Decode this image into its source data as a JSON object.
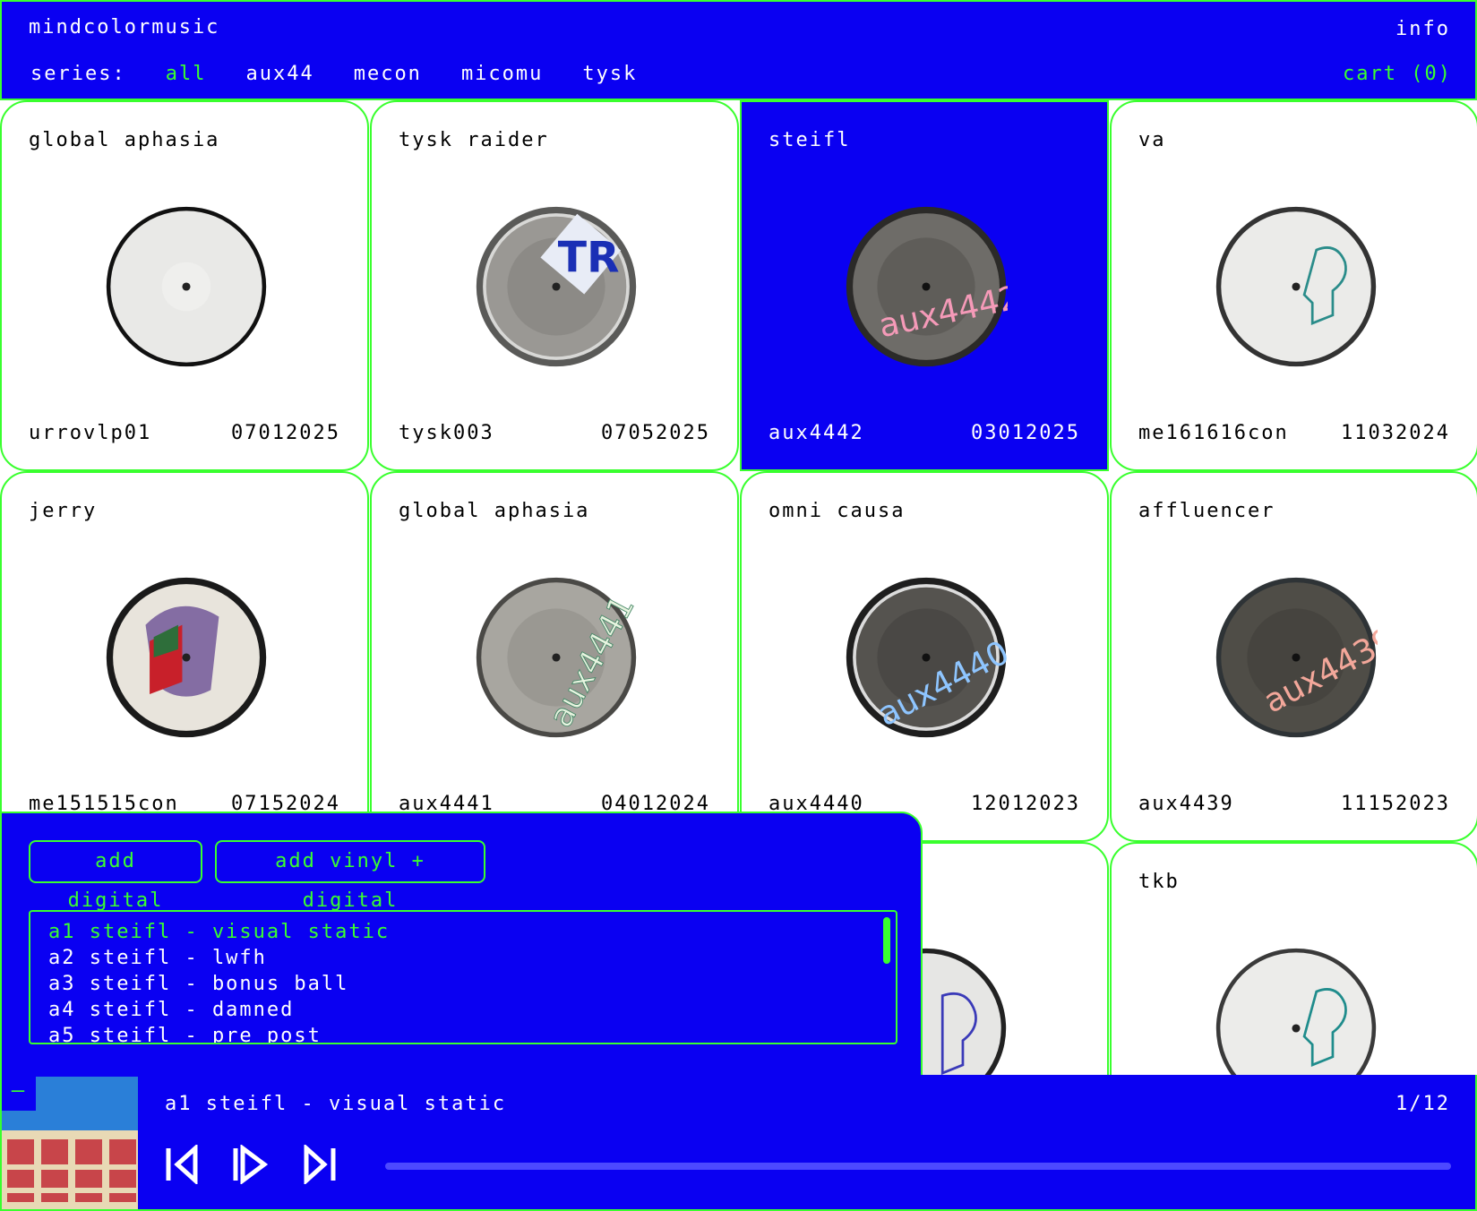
{
  "header": {
    "title": "mindcolormusic",
    "info_label": "info",
    "series_label": "series:",
    "series": [
      "all",
      "aux44",
      "mecon",
      "micomu",
      "tysk"
    ],
    "active_series": "all",
    "cart_label": "cart (0)"
  },
  "releases": [
    {
      "artist": "global aphasia",
      "catno": "urrovlp01",
      "date": "07012025",
      "disc": "white-plain"
    },
    {
      "artist": "tysk raider",
      "catno": "tysk003",
      "date": "07052025",
      "disc": "silver-tr-logo"
    },
    {
      "artist": "steifl",
      "catno": "aux4442",
      "date": "03012025",
      "disc": "dark-aux-pink",
      "selected": true
    },
    {
      "artist": "va",
      "catno": "me161616con",
      "date": "11032024",
      "disc": "white-mecon-logo"
    },
    {
      "artist": "jerry",
      "catno": "me151515con",
      "date": "07152024",
      "disc": "illustrated-mecon"
    },
    {
      "artist": "global aphasia",
      "catno": "aux4441",
      "date": "04012024",
      "disc": "silver-aux-holo"
    },
    {
      "artist": "omni causa",
      "catno": "aux4440",
      "date": "12012023",
      "disc": "dark-aux-blue"
    },
    {
      "artist": "affluencer",
      "catno": "aux4439",
      "date": "11152023",
      "disc": "dark-aux-salmon"
    },
    {
      "artist": "",
      "catno": "",
      "date": "",
      "disc": "white-mecon-blue"
    },
    {
      "artist": "tkb",
      "catno": "",
      "date": "",
      "disc": "white-mecon-teal"
    }
  ],
  "colors": {
    "blue": "#0a00f2",
    "green": "#39ff2e",
    "white": "#ffffff"
  },
  "panel": {
    "add_digital": "add digital",
    "add_vinyl_digital": "add vinyl + digital",
    "tracks": [
      "a1 steifl - visual static",
      "a2 steifl - lwfh",
      "a3 steifl - bonus ball",
      "a4 steifl - damned",
      "a5 steifl - pre post"
    ],
    "active_track_index": 0
  },
  "player": {
    "collapse_label": "–",
    "now_playing": "a1 steifl - visual static",
    "counter": "1/12",
    "icons": [
      "prev-icon",
      "play-icon",
      "next-icon"
    ],
    "progress": 0.0
  }
}
